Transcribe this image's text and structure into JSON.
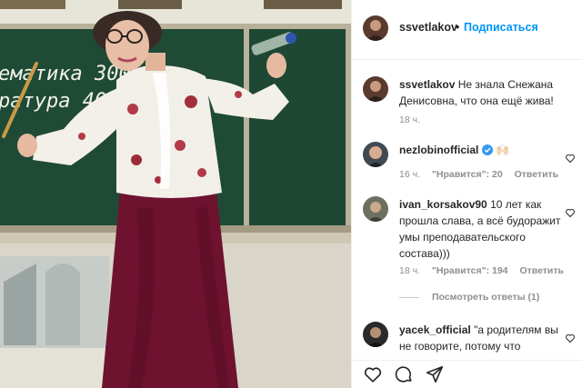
{
  "post": {
    "author": "ssvetlakov",
    "separator": "•",
    "follow_label": "Подписаться"
  },
  "caption": {
    "username": "ssvetlakov",
    "text": "Не знала Снежана Денисовна, что она ещё жива!",
    "time": "18 ч."
  },
  "comments": [
    {
      "username": "nezlobinofficial",
      "text": "🙌🏻",
      "verified": true,
      "time": "16 ч.",
      "likes": "\"Нравится\": 20",
      "reply_label": "Ответить"
    },
    {
      "username": "ivan_korsakov90",
      "text": "10 лет как прошла слава, а всё будоражит умы преподавательского состава)))",
      "time": "18 ч.",
      "likes": "\"Нравится\": 194",
      "reply_label": "Ответить",
      "view_replies": "Посмотреть ответы (1)"
    },
    {
      "username": "yacek_official",
      "text": "\"а родителям вы не говорите, потому что"
    }
  ],
  "board": {
    "line1": "ематика 300",
    "line2": "ратура 400"
  },
  "icons": [
    "like-icon",
    "comment-icon",
    "share-icon",
    "verified-badge-icon",
    "comment-like-icon"
  ],
  "colors": {
    "link": "#0095f6",
    "muted": "#8e8e8e",
    "text": "#262626",
    "board": "#1f4a36",
    "skirt": "#6e1230"
  }
}
